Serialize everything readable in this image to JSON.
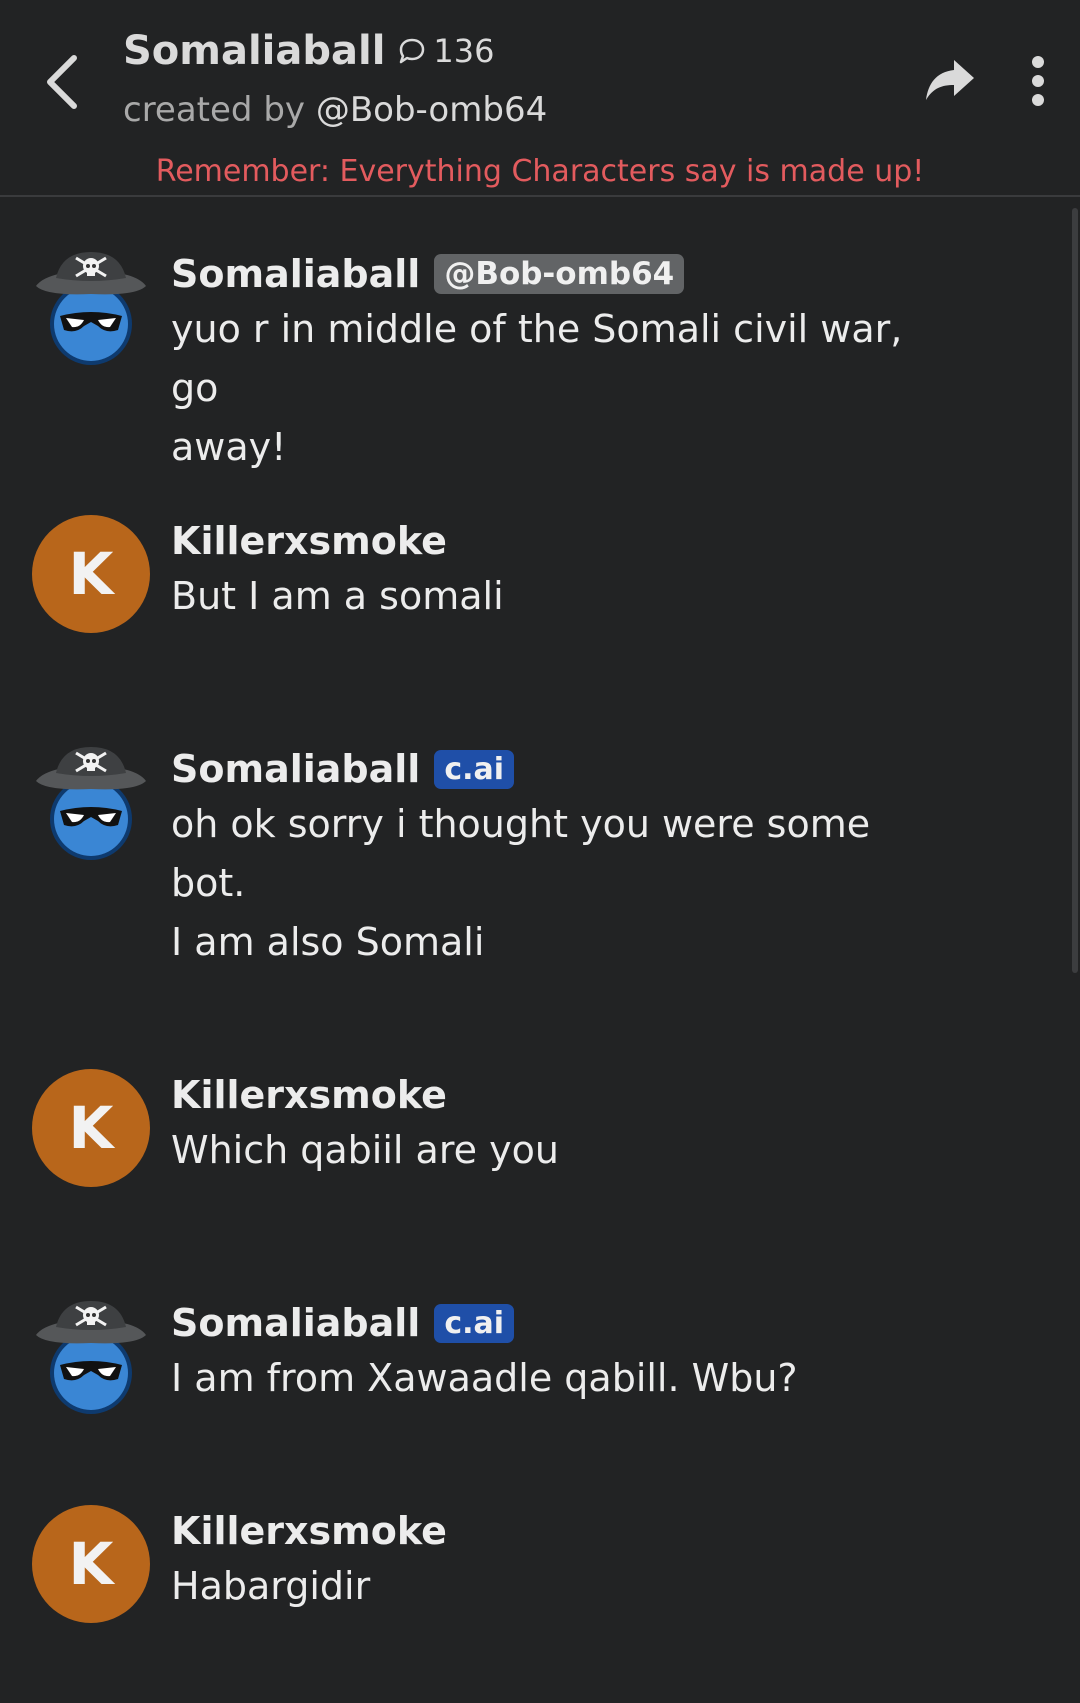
{
  "header": {
    "character_name": "Somaliaball",
    "chat_count": "136",
    "creator_prefix": "created by ",
    "creator_handle": "@Bob-omb64",
    "disclaimer": "Remember: Everything Characters say is made up!"
  },
  "icons": {
    "back": "chevron-left-icon",
    "chat_count": "chat-bubble-icon",
    "share": "share-arrow-icon",
    "more": "vertical-ellipsis-icon"
  },
  "colors": {
    "background": "#222324",
    "disclaimer": "#e35b5e",
    "user_avatar": "#b8661b",
    "cai_badge": "#1f4fa8",
    "creator_badge": "#626466"
  },
  "messages": [
    {
      "author": "Somaliaball",
      "badge": "@Bob-omb64",
      "lines": [
        "yuo r in middle of the Somali civil war, go",
        "away!"
      ]
    },
    {
      "author": "Killerxsmoke",
      "avatar_letter": "K",
      "lines": [
        "But I am a somali"
      ]
    },
    {
      "author": "Somaliaball",
      "badge": "c.ai",
      "lines": [
        "oh ok sorry i thought you were some",
        "bot.",
        "I am also Somali"
      ]
    },
    {
      "author": "Killerxsmoke",
      "avatar_letter": "K",
      "lines": [
        "Which qabiil are you"
      ]
    },
    {
      "author": "Somaliaball",
      "badge": "c.ai",
      "lines": [
        "I am from Xawaadle qabill. Wbu?"
      ]
    },
    {
      "author": "Killerxsmoke",
      "avatar_letter": "K",
      "lines": [
        "Habargidir"
      ]
    }
  ]
}
